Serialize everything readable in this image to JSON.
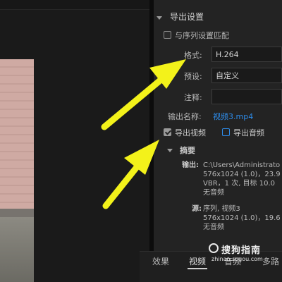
{
  "export_settings": {
    "section_title": "导出设置",
    "match_sequence_label": "与序列设置匹配",
    "format_label": "格式:",
    "format_value": "H.264",
    "preset_label": "预设:",
    "preset_value": "自定义",
    "comment_label": "注释:",
    "comment_value": "",
    "output_name_label": "输出名称:",
    "output_name_value": "视频3.mp4",
    "export_video_label": "导出视频",
    "export_audio_label": "导出音频",
    "export_video_checked": true,
    "export_audio_checked": false
  },
  "summary": {
    "title": "摘要",
    "output_label": "输出:",
    "output_lines": [
      "C:\\Users\\Administrato",
      "576x1024 (1.0)，23.9",
      "VBR，1 次, 目标 10.0",
      "无音频"
    ],
    "source_label": "源:",
    "source_lines": [
      "序列, 视频3",
      "576x1024 (1.0)，19.6",
      "无音频"
    ]
  },
  "bottom_tabs": {
    "effects": "效果",
    "video": "视频",
    "audio": "音频",
    "multiplex": "多路"
  },
  "watermark": {
    "text": "搜狗指南",
    "url": "zhinan.sogou.com"
  },
  "colors": {
    "link_blue": "#2d8ceb",
    "arrow_yellow": "#f3f21a"
  }
}
